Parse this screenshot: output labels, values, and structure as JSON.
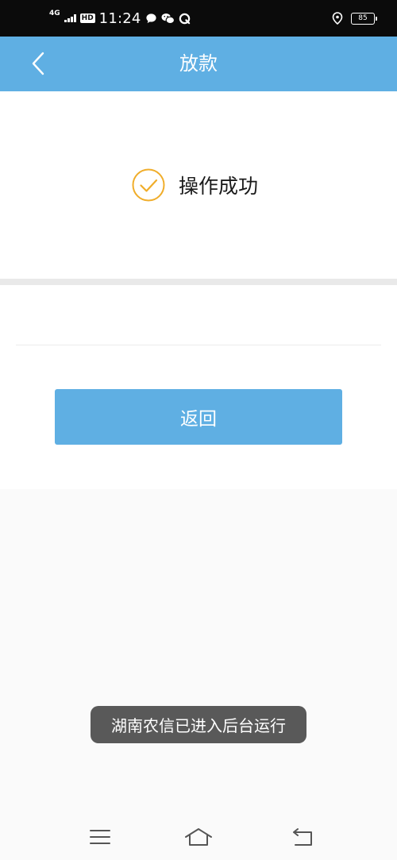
{
  "status_bar": {
    "network": "4G",
    "hd": "HD",
    "time": "11:24",
    "battery": "85",
    "icons": [
      "signal-icon",
      "chat-bubble-icon",
      "wechat-icon",
      "qq-browser-icon",
      "location-icon",
      "battery-icon"
    ]
  },
  "nav": {
    "title": "放款",
    "back_icon": "chevron-left-icon"
  },
  "result": {
    "icon": "check-circle-icon",
    "message": "操作成功"
  },
  "actions": {
    "return_label": "返回"
  },
  "toast": {
    "message": "湖南农信已进入后台运行"
  },
  "system_nav": {
    "icons": [
      "menu-icon",
      "home-icon",
      "back-icon"
    ]
  },
  "colors": {
    "primary": "#5fafe3",
    "success_check": "#f0ad2a",
    "status_bar_bg": "#0b0b0b",
    "toast_bg": "#595959"
  }
}
